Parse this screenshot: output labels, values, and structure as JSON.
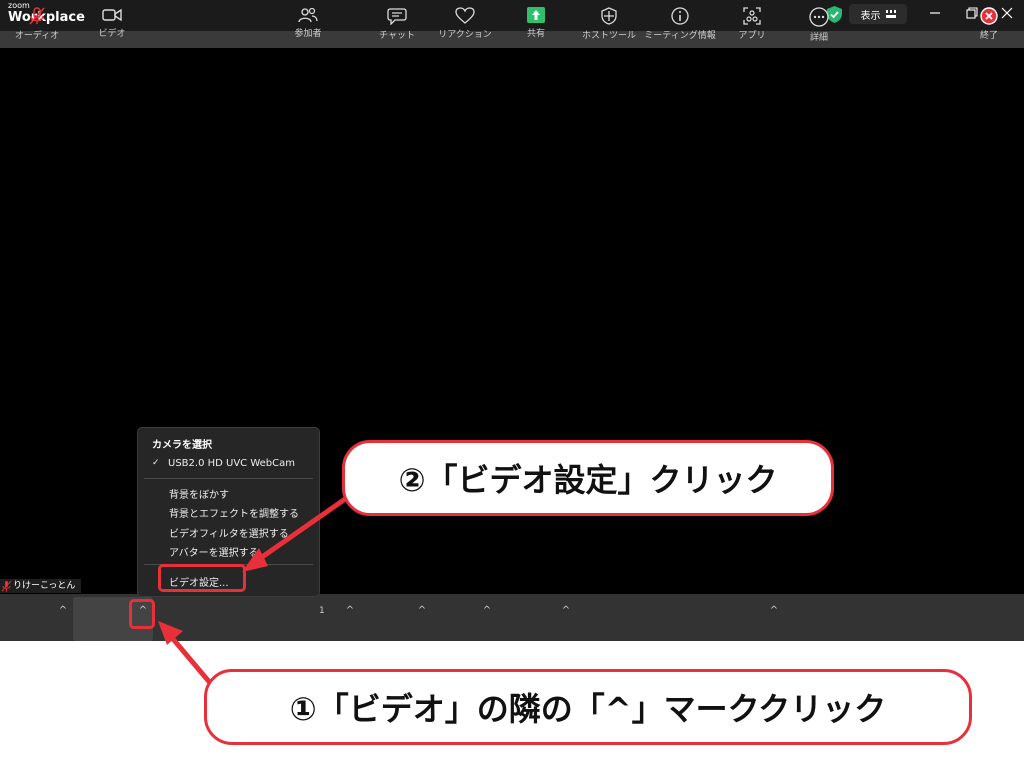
{
  "app": {
    "logo_small": "zoom",
    "logo_main": "Workplace",
    "view_label": "表示"
  },
  "meeting": {
    "participant_name": "りけーこっとん",
    "participant_count": "1"
  },
  "toolbar": {
    "audio_label": "オーディオ",
    "video_label": "ビデオ",
    "participants_label": "参加者",
    "chat_label": "チャット",
    "reaction_label": "リアクション",
    "share_label": "共有",
    "hosttools_label": "ホストツール",
    "meetinginfo_label": "ミーティング情報",
    "apps_label": "アプリ",
    "more_label": "詳細",
    "end_label": "終了",
    "caret": "^"
  },
  "video_menu": {
    "header": "カメラを選択",
    "selected_check": "✓",
    "camera": "USB2.0 HD UVC WebCam",
    "items": [
      "背景をぼかす",
      "背景とエフェクトを調整する",
      "ビデオフィルタを選択する",
      "アバターを選択する"
    ],
    "settings": "ビデオ設定..."
  },
  "annotations": {
    "step1": "①「ビデオ」の隣の「^」マーククリック",
    "step2": "②「ビデオ設定」クリック"
  },
  "colors": {
    "accent_red": "#e8303a",
    "share_green": "#2ec06a",
    "shield_green": "#2bb673"
  }
}
